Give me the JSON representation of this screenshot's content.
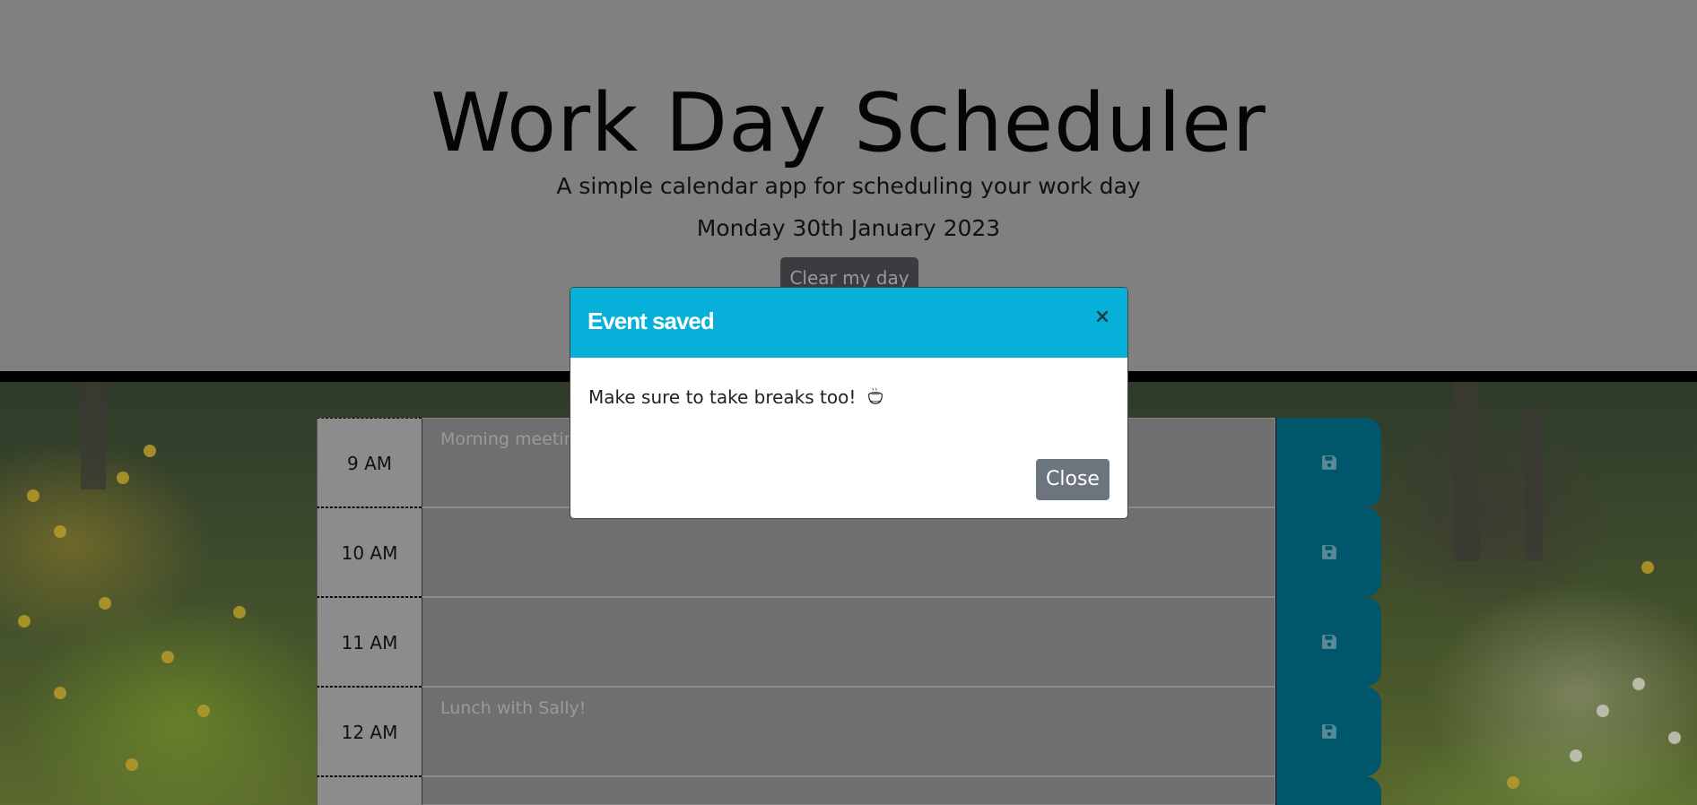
{
  "header": {
    "title": "Work Day Scheduler",
    "lead": "A simple calendar app for scheduling your work day",
    "current_date": "Monday 30th January 2023",
    "clear_button": "Clear my day"
  },
  "schedule": {
    "rows": [
      {
        "hour": "9 AM",
        "event": "Morning meeting"
      },
      {
        "hour": "10 AM",
        "event": ""
      },
      {
        "hour": "11 AM",
        "event": ""
      },
      {
        "hour": "12 AM",
        "event": "Lunch with Sally!"
      },
      {
        "hour": "",
        "event": ""
      }
    ],
    "save_icon": "floppy-disk-icon"
  },
  "modal": {
    "title": "Event saved",
    "message": "Make sure to take breaks too!",
    "message_icon": "coffee-cup-icon",
    "close_x": "×",
    "close_button": "Close"
  },
  "colors": {
    "header_bg": "#808080",
    "modal_header": "#06b0d8",
    "save_button": "#00566a",
    "close_button": "#6c757d"
  }
}
